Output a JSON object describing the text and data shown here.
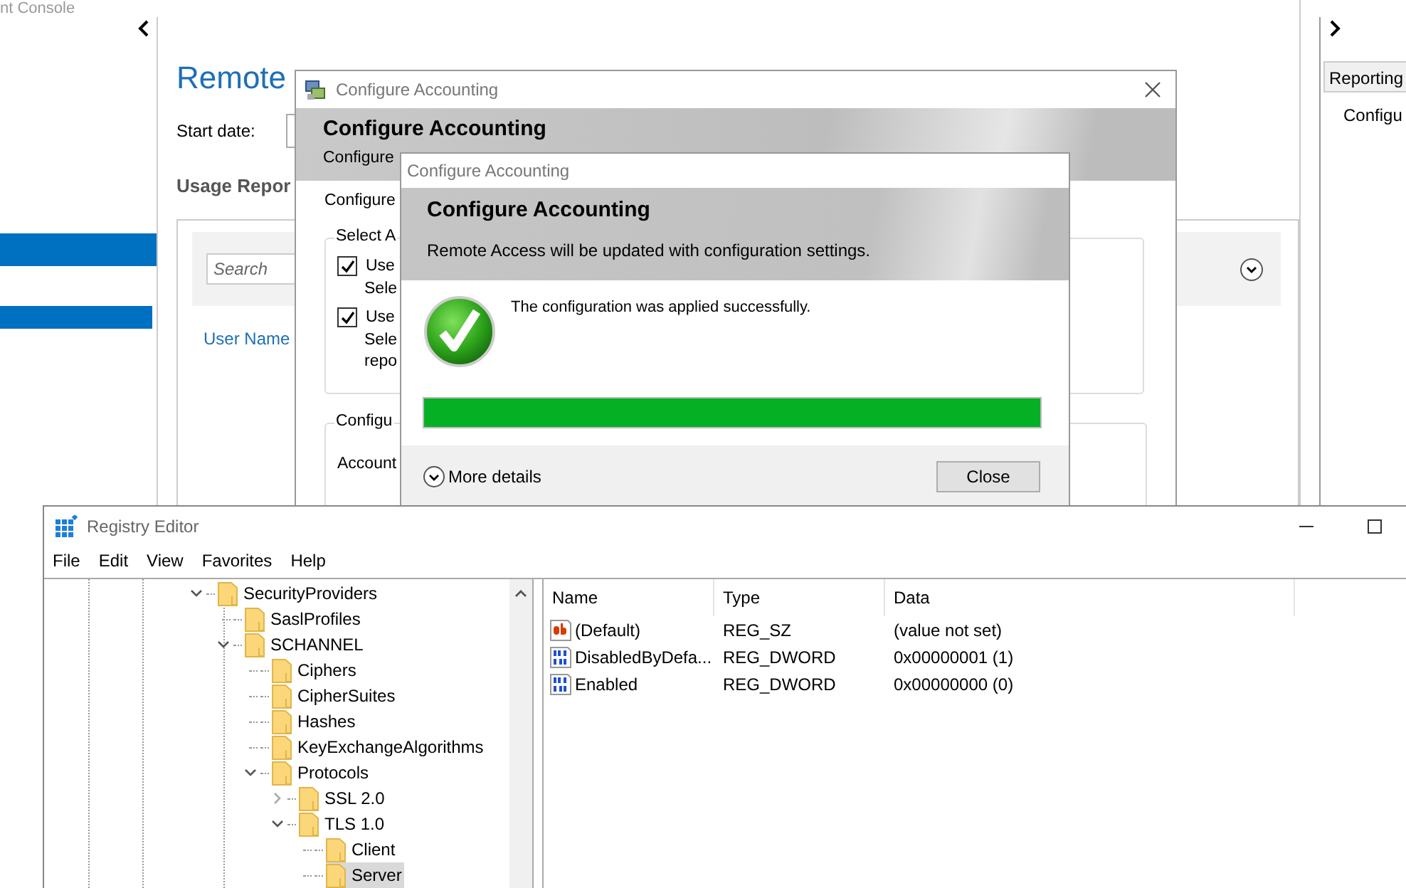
{
  "console": {
    "title": "nt Console",
    "heading": "Remote",
    "start_date_label": "Start date:",
    "usage_heading": "Usage Repor",
    "search": {
      "placeholder": "Search"
    },
    "column": "User Name",
    "side_tab": "Reporting",
    "side_item": "Configu"
  },
  "accounting_dialog": {
    "title": "Configure Accounting",
    "heading": "Configure Accounting",
    "subheading": "Configure",
    "intro": "Configure",
    "group_1": {
      "legend": "Select A",
      "options": [
        {
          "label": "Use",
          "description_lines": [
            "Sele"
          ],
          "checked": true
        },
        {
          "label": "Use",
          "description_lines": [
            "Sele",
            "repo"
          ],
          "checked": true
        }
      ]
    },
    "group_2": {
      "legend": "Configu",
      "field_label": "Account"
    }
  },
  "progress_dialog": {
    "title": "Configure Accounting",
    "heading": "Configure Accounting",
    "subtitle": "Remote Access will be updated with configuration settings.",
    "message": "The configuration was applied successfully.",
    "progress": {
      "level": 1
    },
    "more_details": "More details",
    "close_button": "Close"
  },
  "registry_editor": {
    "title": "Registry Editor",
    "menu": [
      "File",
      "Edit",
      "View",
      "Favorites",
      "Help"
    ],
    "tree": [
      {
        "label": "SecurityProviders",
        "kind": "expanded",
        "selected": false,
        "children": [
          {
            "label": "SaslProfiles",
            "kind": "leaf",
            "selected": false
          },
          {
            "label": "SCHANNEL",
            "kind": "expanded",
            "selected": false,
            "children": [
              {
                "label": "Ciphers",
                "kind": "leaf",
                "selected": false
              },
              {
                "label": "CipherSuites",
                "kind": "leaf",
                "selected": false
              },
              {
                "label": "Hashes",
                "kind": "leaf",
                "selected": false
              },
              {
                "label": "KeyExchangeAlgorithms",
                "kind": "leaf",
                "selected": false
              },
              {
                "label": "Protocols",
                "kind": "expanded",
                "selected": false,
                "children": [
                  {
                    "label": "SSL 2.0",
                    "kind": "collapsed",
                    "selected": false
                  },
                  {
                    "label": "TLS 1.0",
                    "kind": "expanded",
                    "selected": false,
                    "children": [
                      {
                        "label": "Client",
                        "kind": "leaf",
                        "selected": false
                      },
                      {
                        "label": "Server",
                        "kind": "leaf",
                        "selected": true
                      }
                    ]
                  }
                ]
              }
            ]
          }
        ]
      }
    ],
    "columns": [
      "Name",
      "Type",
      "Data"
    ],
    "rows": [
      {
        "kind": "string",
        "name": "(Default)",
        "type": "REG_SZ",
        "data": "(value not set)"
      },
      {
        "kind": "binary",
        "name": "DisabledByDefa...",
        "type": "REG_DWORD",
        "data": "0x00000001 (1)"
      },
      {
        "kind": "binary",
        "name": "Enabled",
        "type": "REG_DWORD",
        "data": "0x00000000 (0)"
      }
    ]
  }
}
